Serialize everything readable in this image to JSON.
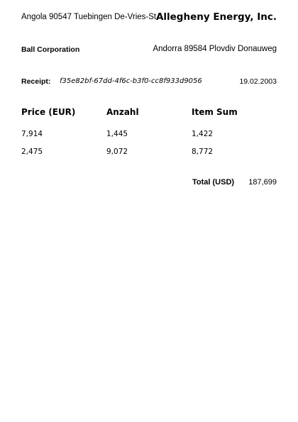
{
  "sender": {
    "address": "Angola 90547 Tuebingen De-Vries-St.",
    "name": "Allegheny Energy, Inc."
  },
  "recipient": {
    "name": "Ball Corporation",
    "address": "Andorra 89584 Plovdiv Donauweg"
  },
  "receipt": {
    "label": "Receipt:",
    "id": "f35e82bf-67dd-4f6c-b3f0-cc8f933d9056",
    "date": "19.02.2003"
  },
  "table": {
    "headers": [
      "Price (EUR)",
      "Anzahl",
      "Item Sum"
    ],
    "rows": [
      [
        "7,914",
        "1,445",
        "1,422"
      ],
      [
        "2,475",
        "9,072",
        "8,772"
      ]
    ]
  },
  "total": {
    "label": "Total (USD)",
    "value": "187,699"
  }
}
